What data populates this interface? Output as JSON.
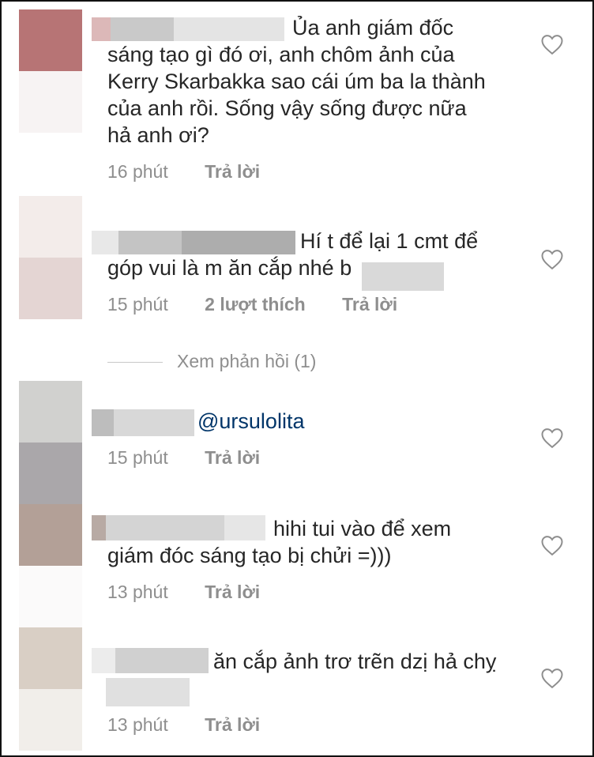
{
  "icons": {
    "like": "heart-outline-icon"
  },
  "colors": {
    "text": "#262626",
    "meta": "#8e8e8e",
    "mention": "#003569"
  },
  "comments": [
    {
      "text": "Ủa anh giám đốc\nsáng tạo gì đó ơi, anh chôm ảnh của\nKerry Skarbakka sao cái úm ba la thành\ncủa anh rồi. Sống vậy sống được nữa\nhả anh ơi?",
      "time": "16 phút",
      "reply": "Trả lời"
    },
    {
      "text": "Hí t để lại 1 cmt để\ngóp vui là m ăn cắp nhé b",
      "time": "15 phút",
      "likes": "2 lượt thích",
      "reply": "Trả lời"
    },
    {
      "mention": "@ursulolita",
      "time": "15 phút",
      "reply": "Trả lời"
    },
    {
      "text": "hihi tui vào để xem\ngiám đóc sáng tạo bị chửi =)))",
      "time": "13 phút",
      "reply": "Trả lời"
    },
    {
      "text": "ăn cắp ảnh trơ trẽn dzị hả chỵ",
      "time": "13 phút",
      "reply": "Trả lời"
    }
  ],
  "view_replies": "Xem phản hồi (1)"
}
